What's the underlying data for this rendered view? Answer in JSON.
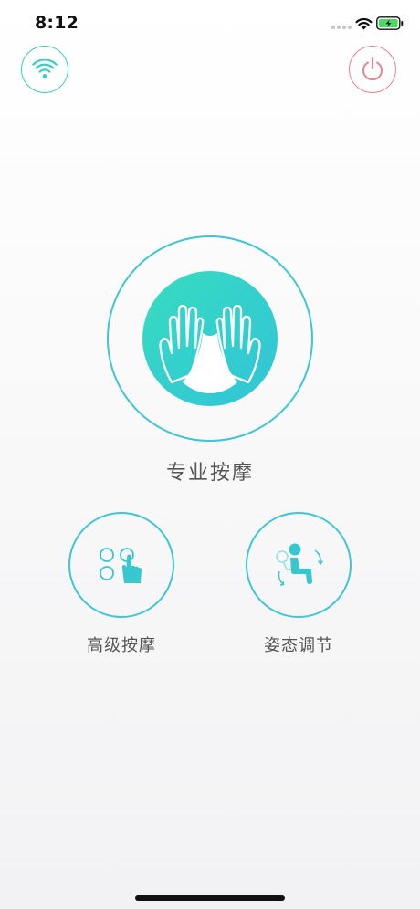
{
  "status_bar": {
    "time": "8:12",
    "battery_state": "charging",
    "battery_color": "#4cd964"
  },
  "top_bar": {
    "wifi_button_icon": "wifi-icon",
    "power_button_icon": "power-icon",
    "wifi_color": "#36cfc9",
    "power_color": "#f0828b"
  },
  "main": {
    "professional_massage_label": "专业按摩",
    "professional_massage_icon": "hands-icon",
    "advanced_massage_label": "高级按摩",
    "advanced_massage_icon": "grid-touch-icon",
    "posture_adjust_label": "姿态调节",
    "posture_adjust_icon": "recline-posture-icon",
    "accent_color": "#3cc6d6"
  }
}
